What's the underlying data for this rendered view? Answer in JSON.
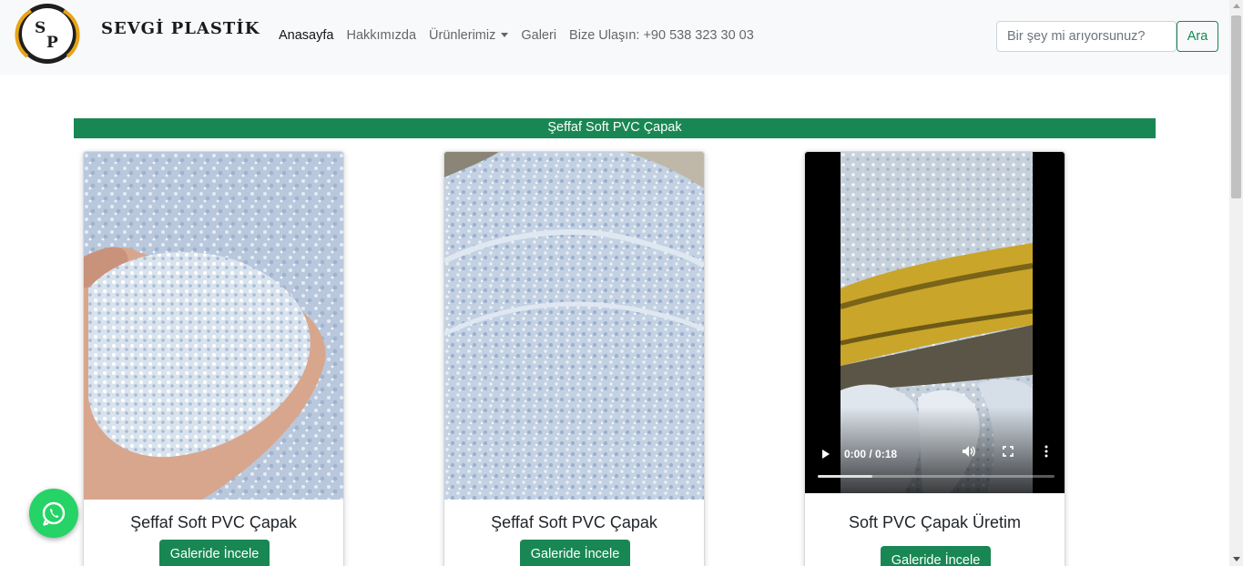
{
  "brand": {
    "name": "SEVGİ  PLASTİK",
    "logo_letters": "S P"
  },
  "nav": {
    "items": [
      {
        "label": "Anasayfa",
        "active": true
      },
      {
        "label": "Hakkımızda"
      },
      {
        "label": "Ürünlerimiz",
        "dropdown": true
      },
      {
        "label": "Galeri"
      },
      {
        "label": "Bize Ulaşın: +90 538 323 30 03"
      }
    ]
  },
  "search": {
    "placeholder": "Bir şey mi arıyorsunuz?",
    "button_label": "Ara"
  },
  "section": {
    "title": "Şeffaf Soft PVC Çapak"
  },
  "cards": [
    {
      "title": "Şeffaf Soft PVC Çapak",
      "button_label": "Galeride İncele",
      "media": "image"
    },
    {
      "title": "Şeffaf Soft PVC Çapak",
      "button_label": "Galeride İncele",
      "media": "image"
    },
    {
      "title": "Soft PVC Çapak Üretim",
      "button_label": "Galeride İncele",
      "media": "video",
      "video_time": "0:00 / 0:18",
      "video_progress": 0.23
    }
  ],
  "colors": {
    "accent": "#198754",
    "whatsapp": "#25d366",
    "navbar_bg": "#f8f9fa"
  },
  "icons": {
    "whatsapp": "whatsapp-icon",
    "play": "play-icon",
    "volume": "volume-icon",
    "fullscreen": "fullscreen-icon",
    "more": "more-options-icon"
  }
}
